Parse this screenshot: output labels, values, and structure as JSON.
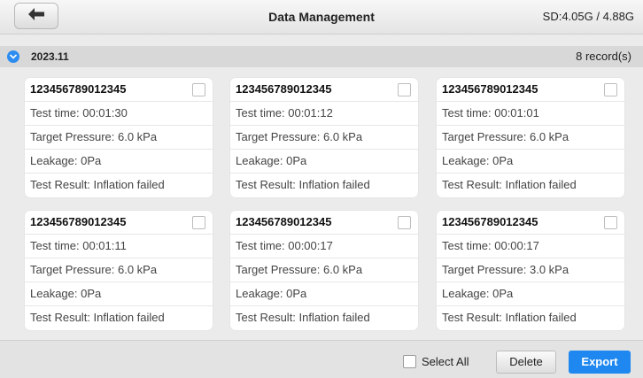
{
  "header": {
    "title": "Data Management",
    "sd": "SD:4.05G / 4.88G"
  },
  "group": {
    "title": "2023.11",
    "count": "8 record(s)"
  },
  "cards": [
    {
      "id": "123456789012345",
      "test_time": "Test time: 00:01:30",
      "target": "Target Pressure: 6.0 kPa",
      "leakage": "Leakage: 0Pa",
      "result": "Test Result: Inflation failed"
    },
    {
      "id": "123456789012345",
      "test_time": "Test time: 00:01:12",
      "target": "Target Pressure: 6.0 kPa",
      "leakage": "Leakage: 0Pa",
      "result": "Test Result: Inflation failed"
    },
    {
      "id": "123456789012345",
      "test_time": "Test time: 00:01:01",
      "target": "Target Pressure: 6.0 kPa",
      "leakage": "Leakage: 0Pa",
      "result": "Test Result: Inflation failed"
    },
    {
      "id": "123456789012345",
      "test_time": "Test time: 00:01:11",
      "target": "Target Pressure: 6.0 kPa",
      "leakage": "Leakage: 0Pa",
      "result": "Test Result: Inflation failed"
    },
    {
      "id": "123456789012345",
      "test_time": "Test time: 00:00:17",
      "target": "Target Pressure: 6.0 kPa",
      "leakage": "Leakage: 0Pa",
      "result": "Test Result: Inflation failed"
    },
    {
      "id": "123456789012345",
      "test_time": "Test time: 00:00:17",
      "target": "Target Pressure: 3.0 kPa",
      "leakage": "Leakage: 0Pa",
      "result": "Test Result: Inflation failed"
    }
  ],
  "footer": {
    "select_all": "Select All",
    "delete": "Delete",
    "export": "Export"
  },
  "icons": {
    "back": "back-arrow-icon",
    "group": "chevron-down-icon"
  },
  "colors": {
    "accent": "#1e87f0"
  }
}
